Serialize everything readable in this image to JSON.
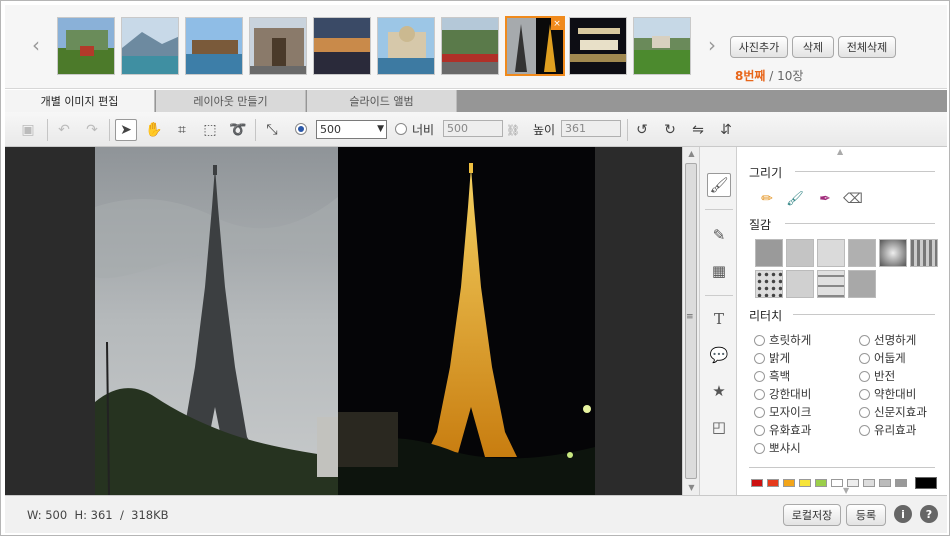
{
  "filmstrip": {
    "thumbnails": [
      {
        "name": "thumb-1"
      },
      {
        "name": "thumb-2"
      },
      {
        "name": "thumb-3"
      },
      {
        "name": "thumb-4"
      },
      {
        "name": "thumb-5"
      },
      {
        "name": "thumb-6"
      },
      {
        "name": "thumb-7"
      },
      {
        "name": "thumb-8"
      },
      {
        "name": "thumb-9"
      },
      {
        "name": "thumb-10"
      }
    ],
    "selected_index": 8,
    "close_glyph": "×",
    "add_photo": "사진추가",
    "delete": "삭제",
    "delete_all": "전체삭제",
    "current": "8번째",
    "separator": " / ",
    "total": "10장"
  },
  "tabs": [
    {
      "label": "개별 이미지 편집",
      "active": true
    },
    {
      "label": "레이아웃 만들기",
      "active": false
    },
    {
      "label": "슬라이드 앨범",
      "active": false
    }
  ],
  "toolbar": {
    "size_value": "500",
    "width_label": "너비",
    "width_value": "500",
    "height_label": "높이",
    "height_value": "361"
  },
  "panel": {
    "draw_heading": "그리기",
    "texture_heading": "질감",
    "retouch_heading": "리터치",
    "retouch_options": [
      "흐릿하게",
      "선명하게",
      "밝게",
      "어둡게",
      "흑백",
      "반전",
      "강한대비",
      "약한대비",
      "모자이크",
      "신문지효과",
      "유화효과",
      "유리효과",
      "뽀샤시"
    ],
    "swatches": [
      "#cc1111",
      "#e63a1c",
      "#f2a51a",
      "#f7e43a",
      "#9bcf4a",
      "#ffffff",
      "#eeeeee",
      "#dddddd",
      "#bbbbbb",
      "#999999"
    ]
  },
  "status": {
    "width": "W: 500",
    "height": "H: 361",
    "divider": "/",
    "filesize": "318KB",
    "local_save": "로컬저장",
    "register": "등록",
    "info_glyph": "i",
    "help_glyph": "?"
  },
  "colors": {
    "accent": "#f08a1c",
    "counter": "#e8661a"
  }
}
